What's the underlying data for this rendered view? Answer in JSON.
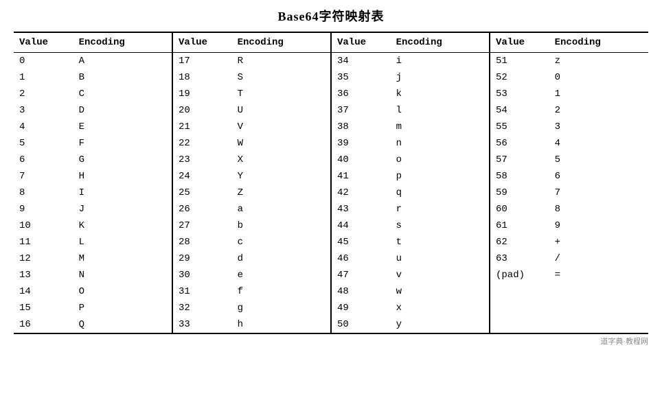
{
  "title": "Base64字符映射表",
  "columns": [
    {
      "value_header": "Value",
      "encoding_header": "Encoding"
    },
    {
      "value_header": "Value",
      "encoding_header": "Encoding"
    },
    {
      "value_header": "Value",
      "encoding_header": "Encoding"
    },
    {
      "value_header": "Value",
      "encoding_header": "Encoding"
    }
  ],
  "rows": [
    [
      {
        "v": "0",
        "e": "A"
      },
      {
        "v": "17",
        "e": "R"
      },
      {
        "v": "34",
        "e": "i"
      },
      {
        "v": "51",
        "e": "z"
      }
    ],
    [
      {
        "v": "1",
        "e": "B"
      },
      {
        "v": "18",
        "e": "S"
      },
      {
        "v": "35",
        "e": "j"
      },
      {
        "v": "52",
        "e": "0"
      }
    ],
    [
      {
        "v": "2",
        "e": "C"
      },
      {
        "v": "19",
        "e": "T"
      },
      {
        "v": "36",
        "e": "k"
      },
      {
        "v": "53",
        "e": "1"
      }
    ],
    [
      {
        "v": "3",
        "e": "D"
      },
      {
        "v": "20",
        "e": "U"
      },
      {
        "v": "37",
        "e": "l"
      },
      {
        "v": "54",
        "e": "2"
      }
    ],
    [
      {
        "v": "4",
        "e": "E"
      },
      {
        "v": "21",
        "e": "V"
      },
      {
        "v": "38",
        "e": "m"
      },
      {
        "v": "55",
        "e": "3"
      }
    ],
    [
      {
        "v": "5",
        "e": "F"
      },
      {
        "v": "22",
        "e": "W"
      },
      {
        "v": "39",
        "e": "n"
      },
      {
        "v": "56",
        "e": "4"
      }
    ],
    [
      {
        "v": "6",
        "e": "G"
      },
      {
        "v": "23",
        "e": "X"
      },
      {
        "v": "40",
        "e": "o"
      },
      {
        "v": "57",
        "e": "5"
      }
    ],
    [
      {
        "v": "7",
        "e": "H"
      },
      {
        "v": "24",
        "e": "Y"
      },
      {
        "v": "41",
        "e": "p"
      },
      {
        "v": "58",
        "e": "6"
      }
    ],
    [
      {
        "v": "8",
        "e": "I"
      },
      {
        "v": "25",
        "e": "Z"
      },
      {
        "v": "42",
        "e": "q"
      },
      {
        "v": "59",
        "e": "7"
      }
    ],
    [
      {
        "v": "9",
        "e": "J"
      },
      {
        "v": "26",
        "e": "a"
      },
      {
        "v": "43",
        "e": "r"
      },
      {
        "v": "60",
        "e": "8"
      }
    ],
    [
      {
        "v": "10",
        "e": "K"
      },
      {
        "v": "27",
        "e": "b"
      },
      {
        "v": "44",
        "e": "s"
      },
      {
        "v": "61",
        "e": "9"
      }
    ],
    [
      {
        "v": "11",
        "e": "L"
      },
      {
        "v": "28",
        "e": "c"
      },
      {
        "v": "45",
        "e": "t"
      },
      {
        "v": "62",
        "e": "+"
      }
    ],
    [
      {
        "v": "12",
        "e": "M"
      },
      {
        "v": "29",
        "e": "d"
      },
      {
        "v": "46",
        "e": "u"
      },
      {
        "v": "63",
        "e": "/"
      }
    ],
    [
      {
        "v": "13",
        "e": "N"
      },
      {
        "v": "30",
        "e": "e"
      },
      {
        "v": "47",
        "e": "v"
      },
      {
        "v": "(pad)",
        "e": "="
      }
    ],
    [
      {
        "v": "14",
        "e": "O"
      },
      {
        "v": "31",
        "e": "f"
      },
      {
        "v": "48",
        "e": "w"
      },
      {
        "v": "",
        "e": ""
      }
    ],
    [
      {
        "v": "15",
        "e": "P"
      },
      {
        "v": "32",
        "e": "g"
      },
      {
        "v": "49",
        "e": "x"
      },
      {
        "v": "",
        "e": ""
      }
    ],
    [
      {
        "v": "16",
        "e": "Q"
      },
      {
        "v": "33",
        "e": "h"
      },
      {
        "v": "50",
        "e": "y"
      },
      {
        "v": "",
        "e": ""
      }
    ]
  ],
  "watermark": "道字典·教程网"
}
